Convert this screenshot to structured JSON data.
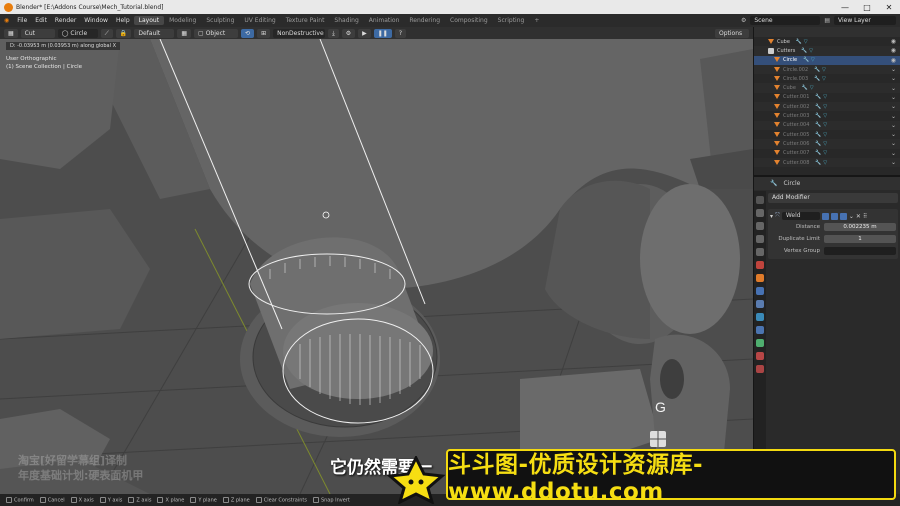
{
  "window": {
    "title": "Blender* [E:\\Addons Course\\Mech_Tutorial.blend]",
    "controls": [
      "—",
      "□",
      "✕"
    ]
  },
  "menubar": {
    "menus": [
      "File",
      "Edit",
      "Render",
      "Window",
      "Help"
    ],
    "workspaces": [
      "Layout",
      "Modeling",
      "Sculpting",
      "UV Editing",
      "Texture Paint",
      "Shading",
      "Animation",
      "Rendering",
      "Compositing",
      "Scripting"
    ],
    "active_workspace": "Layout",
    "scene": "Scene",
    "view_layer": "View Layer"
  },
  "toolheader": {
    "mode": "Cut",
    "shape": "Circle",
    "transform": "Default",
    "target": "Object",
    "boolean_mode": "NonDestructive",
    "options": "Options"
  },
  "viewport": {
    "operation_info": "D: -0.03953 m (0.03953 m) along global X",
    "view_name": "User Orthographic",
    "collection": "(1) Scene Collection | Circle",
    "key_overlay": "G",
    "subtitle": "它仍然需要一",
    "watermark_line1": "淘宝[好留学幕组]译制",
    "watermark_line2": "年度基础计划:硬表面机甲"
  },
  "outliner": {
    "items": [
      {
        "name": "Cube",
        "icon": "triangle-icon",
        "state": "normal"
      },
      {
        "name": "Cutters",
        "icon": "box-icon",
        "state": "normal"
      },
      {
        "name": "Circle",
        "icon": "triangle-icon",
        "state": "selected"
      },
      {
        "name": "Circle.002",
        "icon": "triangle-icon",
        "state": "dim"
      },
      {
        "name": "Circle.003",
        "icon": "triangle-icon",
        "state": "dim"
      },
      {
        "name": "Cube",
        "icon": "triangle-icon",
        "state": "dim"
      },
      {
        "name": "Cutter.001",
        "icon": "triangle-icon",
        "state": "dim"
      },
      {
        "name": "Cutter.002",
        "icon": "triangle-icon",
        "state": "dim"
      },
      {
        "name": "Cutter.003",
        "icon": "triangle-icon",
        "state": "dim"
      },
      {
        "name": "Cutter.004",
        "icon": "triangle-icon",
        "state": "dim"
      },
      {
        "name": "Cutter.005",
        "icon": "triangle-icon",
        "state": "dim"
      },
      {
        "name": "Cutter.006",
        "icon": "triangle-icon",
        "state": "dim"
      },
      {
        "name": "Cutter.007",
        "icon": "triangle-icon",
        "state": "dim"
      },
      {
        "name": "Cutter.008",
        "icon": "triangle-icon",
        "state": "dim"
      }
    ]
  },
  "properties": {
    "object_name": "Circle",
    "add_modifier": "Add Modifier",
    "modifier_name": "Weld",
    "fields": [
      {
        "label": "Distance",
        "value": "0.002235 m"
      },
      {
        "label": "Duplicate Limit",
        "value": "1"
      },
      {
        "label": "Vertex Group",
        "value": ""
      }
    ]
  },
  "statusbar": {
    "items": [
      "Confirm",
      "Cancel",
      "X axis",
      "Y axis",
      "Z axis",
      "X plane",
      "Y plane",
      "Z plane",
      "Clear Constraints",
      "Snap Invert"
    ]
  },
  "banner": {
    "text": "斗斗图-优质设计资源库-www.ddotu.com"
  },
  "colors": {
    "accent_blue": "#4772b3",
    "selection": "#344f7a",
    "banner_yellow": "#f6de12",
    "blender_orange": "#e87d0d"
  }
}
